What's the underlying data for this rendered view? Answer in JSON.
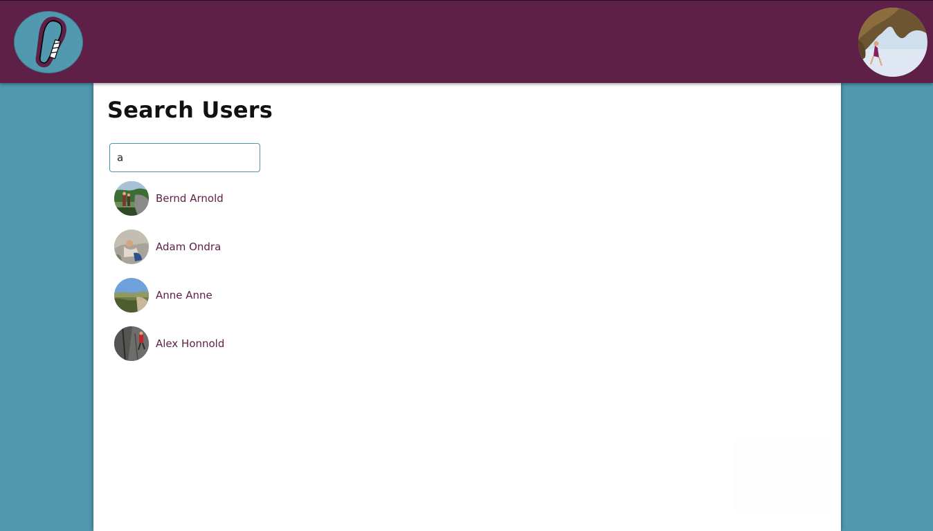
{
  "header": {
    "logo_icon": "carabiner-icon",
    "profile_avatar_icon": "climber-photo-avatar"
  },
  "main": {
    "title": "Search Users",
    "search": {
      "value": "a",
      "placeholder": ""
    },
    "results": [
      {
        "name": "Bernd Arnold",
        "avatar": "forest-climbers-photo"
      },
      {
        "name": "Adam Ondra",
        "avatar": "boulder-climber-photo"
      },
      {
        "name": "Anne Anne",
        "avatar": "valley-landscape-photo"
      },
      {
        "name": "Alex Honnold",
        "avatar": "rock-wall-climber-photo"
      }
    ]
  },
  "colors": {
    "header_bg": "#5f2047",
    "page_bg": "#5099ae",
    "link_text": "#5f2047",
    "panel_bg": "#ffffff"
  }
}
